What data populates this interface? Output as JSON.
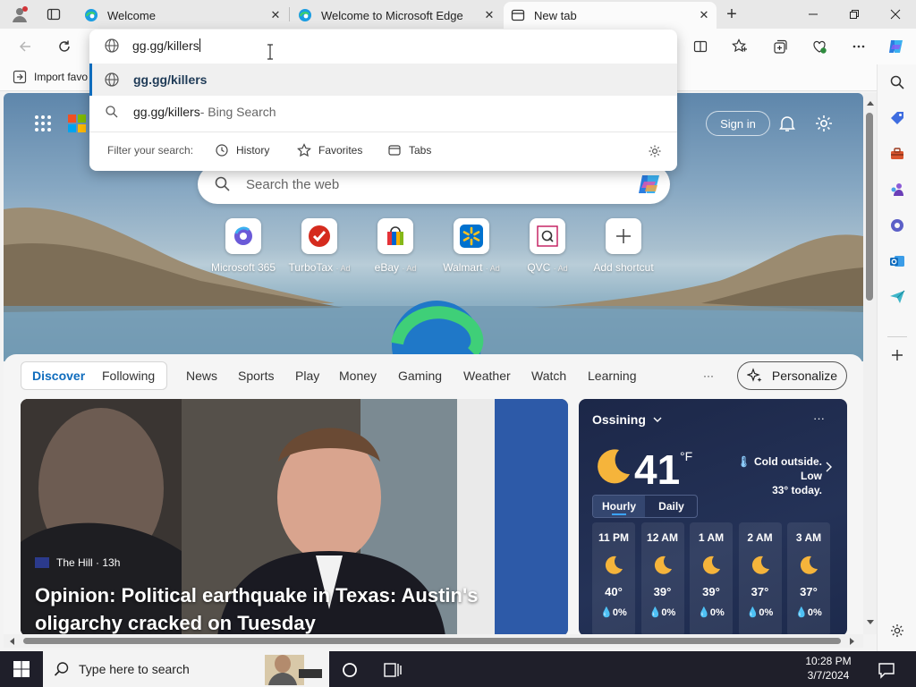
{
  "tabs": [
    {
      "title": "Welcome",
      "active": false
    },
    {
      "title": "Welcome to Microsoft Edge",
      "active": false
    },
    {
      "title": "New tab",
      "active": true
    }
  ],
  "omnibox": {
    "value": "gg.gg/killers"
  },
  "suggestions": [
    {
      "text": "gg.gg/killers",
      "suffix": ""
    },
    {
      "text": "gg.gg/killers",
      "suffix": " - Bing Search"
    }
  ],
  "filter": {
    "label": "Filter your search:",
    "options": [
      "History",
      "Favorites",
      "Tabs"
    ]
  },
  "favorites_bar": {
    "import_label": "Import favo"
  },
  "newtab": {
    "sign_in": "Sign in",
    "search_placeholder": "Search the web",
    "shortcuts": [
      {
        "label": "Microsoft 365",
        "ad": ""
      },
      {
        "label": "TurboTax",
        "ad": "· Ad"
      },
      {
        "label": "eBay",
        "ad": "· Ad"
      },
      {
        "label": "Walmart",
        "ad": "· Ad"
      },
      {
        "label": "QVC",
        "ad": "· Ad"
      },
      {
        "label": "Add shortcut",
        "ad": ""
      }
    ]
  },
  "feed_nav": {
    "tabs": [
      "Discover",
      "Following",
      "News",
      "Sports",
      "Play",
      "Money",
      "Gaming",
      "Weather",
      "Watch",
      "Learning"
    ],
    "more": "···",
    "personalize": "Personalize"
  },
  "article": {
    "source": "The Hill · 13h",
    "headline_line1": "Opinion: Political earthquake in Texas: Austin's",
    "headline_line2": "oligarchy cracked on Tuesday"
  },
  "weather": {
    "location": "Ossining",
    "temp": "41",
    "unit": "°F",
    "note_line1": "Cold outside. Low",
    "note_line2": "33° today.",
    "tabs": [
      "Hourly",
      "Daily"
    ],
    "hours": [
      {
        "time": "11 PM",
        "temp": "40°",
        "precip": "0%"
      },
      {
        "time": "12 AM",
        "temp": "39°",
        "precip": "0%"
      },
      {
        "time": "1 AM",
        "temp": "39°",
        "precip": "0%"
      },
      {
        "time": "2 AM",
        "temp": "37°",
        "precip": "0%"
      },
      {
        "time": "3 AM",
        "temp": "37°",
        "precip": "0%"
      }
    ]
  },
  "taskbar": {
    "search_placeholder": "Type here to search",
    "time": "10:28 PM",
    "date": "3/7/2024"
  },
  "colors": {
    "accent": "#0f6cbd",
    "taskbar": "#1f1f2a",
    "weather_bg": "#1e2a4a"
  }
}
